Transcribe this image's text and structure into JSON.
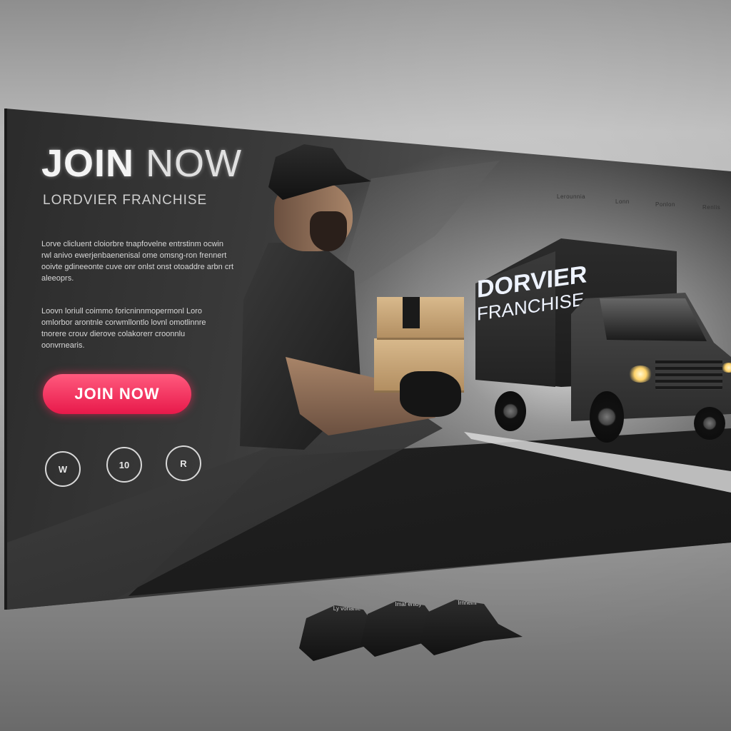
{
  "banner": {
    "title_bold": "JOIN",
    "title_light": "NOW",
    "subtitle": "LORDVIER FRANCHISE"
  },
  "body_text": {
    "paragraph1": "Lorve clicluent cloiorbre tnapfovelne entrstinm ocwin rwl anivo ewerjenbaenenisal ome omsng-ron frennert ooivte gdineeonte cuve onr onlst onst otoaddre arbn crt aleeoprs.",
    "paragraph2": "Loovn loriull coimmo foricninnmopermonl Loro omlorbor arontnle corwmllontlo lovnl omotlinnre tnorere crouv dierove colakorerr croonnlu oonvrnearis."
  },
  "cta": {
    "label": "JOIN NOW"
  },
  "features": [
    {
      "icon_text": "W",
      "caption": "Ly vonanle"
    },
    {
      "icon_text": "10",
      "caption": "Imaf enloy"
    },
    {
      "icon_text": "R",
      "caption": "Irnnelnr"
    }
  ],
  "nav": {
    "items": [
      "Lerounnia",
      "Lonn",
      "Ponlon",
      "Renlis"
    ]
  },
  "truck": {
    "logo_line1": "DORVIER",
    "logo_line2": "FRANCHISE"
  },
  "colors": {
    "accent": "#e8194a",
    "banner_dark": "#2a2a2a",
    "wall": "#a8a8a8"
  }
}
